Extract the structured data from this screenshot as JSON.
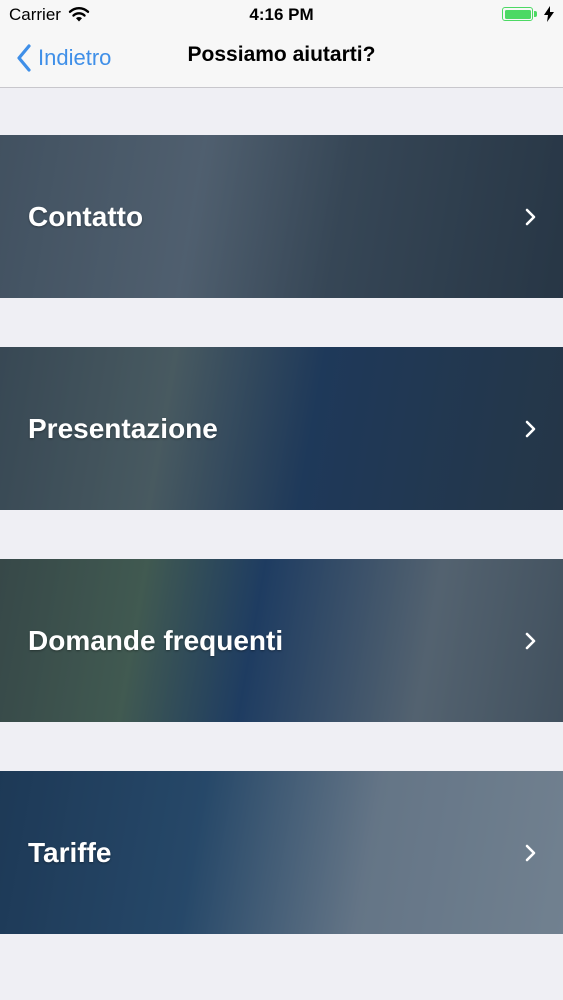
{
  "status_bar": {
    "carrier": "Carrier",
    "time": "4:16 PM",
    "battery_color": "#4cd964"
  },
  "nav": {
    "back_label": "Indietro",
    "title": "Possiamo aiutarti?",
    "accent_color": "#3f8fe8"
  },
  "menu": {
    "items": [
      {
        "label": "Contatto",
        "icon": "chevron-right-icon"
      },
      {
        "label": "Presentazione",
        "icon": "chevron-right-icon"
      },
      {
        "label": "Domande frequenti",
        "icon": "chevron-right-icon"
      },
      {
        "label": "Tariffe",
        "icon": "chevron-right-icon"
      }
    ]
  }
}
